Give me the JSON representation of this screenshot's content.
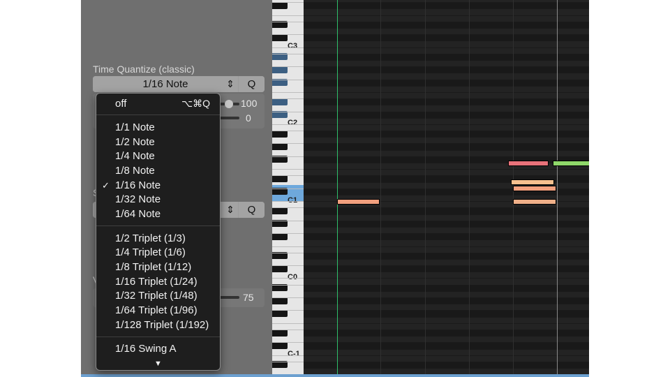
{
  "inspector": {
    "section_title": "Time Quantize (classic)",
    "quantize_value": "1/16 Note",
    "select_arrows": "⇕",
    "q_label": "Q",
    "strength_value": "100",
    "swing_value": "0",
    "second_select_arrows": "⇕",
    "second_q_label": "Q",
    "partial_s": "S",
    "partial_v": "V",
    "velocity_value": "75"
  },
  "keyboard": {
    "labels": [
      "C3",
      "C2",
      "C1",
      "C0",
      "C-1"
    ]
  },
  "menu": {
    "off": {
      "label": "off",
      "shortcut": "⌥⌘Q"
    },
    "checkmark": "✓",
    "group1": [
      "1/1 Note",
      "1/2 Note",
      "1/4 Note",
      "1/8 Note",
      "1/16 Note",
      "1/32 Note",
      "1/64 Note"
    ],
    "group2": [
      "1/2 Triplet (1/3)",
      "1/4 Triplet (1/6)",
      "1/8 Triplet (1/12)",
      "1/16 Triplet (1/24)",
      "1/32 Triplet (1/48)",
      "1/64 Triplet (1/96)",
      "1/128 Triplet (1/192)"
    ],
    "group3": [
      "1/16 Swing A"
    ],
    "more_indicator": "▼",
    "selected": "1/16 Note"
  },
  "colors": {
    "note_red": "#e8727a",
    "note_green": "#8fd86a",
    "note_orange": "#f0b089",
    "note_salmon": "#f2a07e",
    "playhead": "#2fbf6a"
  }
}
